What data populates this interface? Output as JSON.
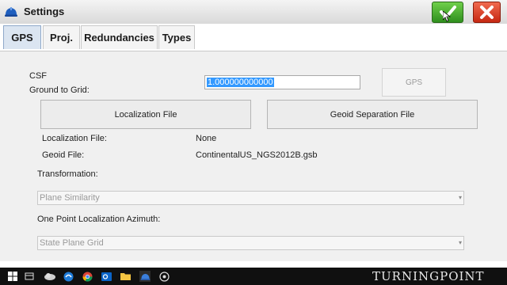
{
  "window": {
    "title": "Settings",
    "title_icon": "hardhat-icon",
    "ok_icon": "checkmark-icon",
    "close_icon": "close-x-icon"
  },
  "tabs": [
    {
      "label": "GPS",
      "active": true
    },
    {
      "label": "Proj."
    },
    {
      "label": "Redundancies"
    },
    {
      "label": "Types"
    }
  ],
  "csf": {
    "label": "CSF",
    "sublabel": "Ground to Grid:",
    "value": "1.000000000000"
  },
  "gps_button": {
    "label": "GPS"
  },
  "buttons": {
    "localization_file": "Localization File",
    "geoid_separation_file": "Geoid Separation File"
  },
  "info": {
    "localization_file_label": "Localization File:",
    "localization_file_value": "None",
    "geoid_file_label": "Geoid File:",
    "geoid_file_value": "ContinentalUS_NGS2012B.gsb"
  },
  "transformation": {
    "label": "Transformation:",
    "value": "Plane Similarity"
  },
  "azimuth": {
    "label": "One Point Localization Azimuth:",
    "value": "State Plane Grid"
  },
  "taskbar": {
    "icons": [
      "windows-start-icon",
      "search-icon",
      "task-view-icon",
      "cloud-icon",
      "edge-icon",
      "chrome-icon",
      "outlook-icon",
      "file-explorer-icon",
      "app-hardhat-icon",
      "settings-app-icon"
    ]
  },
  "watermark": {
    "text": "TURNINGPOINT"
  },
  "colors": {
    "ok_green": "#3fa02a",
    "close_red": "#d63a1f",
    "selection_blue": "#3399ff",
    "active_tab": "#dbe5f1"
  }
}
